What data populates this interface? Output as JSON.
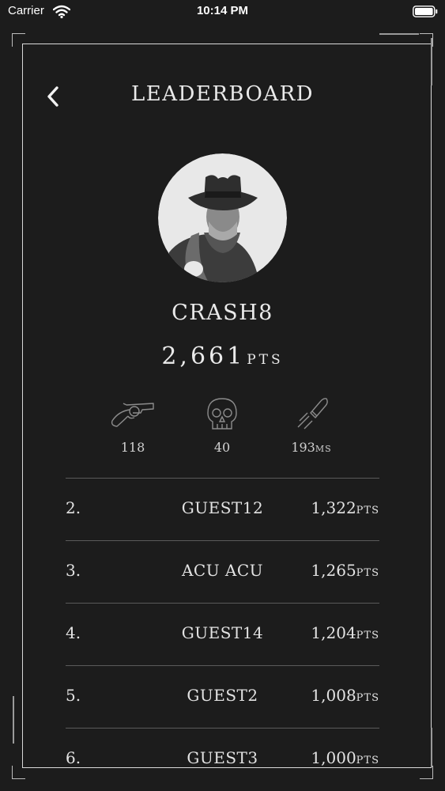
{
  "status_bar": {
    "carrier": "Carrier",
    "time": "10:14 PM"
  },
  "header": {
    "title": "LEADERBOARD",
    "back_icon": "chevron-left-icon"
  },
  "profile": {
    "username": "CRASH8",
    "points": "2,661",
    "points_unit": "PTS"
  },
  "stats": [
    {
      "icon": "revolver-icon",
      "value": "118",
      "unit": ""
    },
    {
      "icon": "skull-icon",
      "value": "40",
      "unit": ""
    },
    {
      "icon": "bullet-icon",
      "value": "193",
      "unit": "MS"
    }
  ],
  "leaderboard": [
    {
      "rank": "2.",
      "name": "GUEST12",
      "points": "1,322",
      "unit": "PTS"
    },
    {
      "rank": "3.",
      "name": "ACU ACU",
      "points": "1,265",
      "unit": "PTS"
    },
    {
      "rank": "4.",
      "name": "GUEST14",
      "points": "1,204",
      "unit": "PTS"
    },
    {
      "rank": "5.",
      "name": "GUEST2",
      "points": "1,008",
      "unit": "PTS"
    },
    {
      "rank": "6.",
      "name": "GUEST3",
      "points": "1,000",
      "unit": "PTS"
    }
  ]
}
